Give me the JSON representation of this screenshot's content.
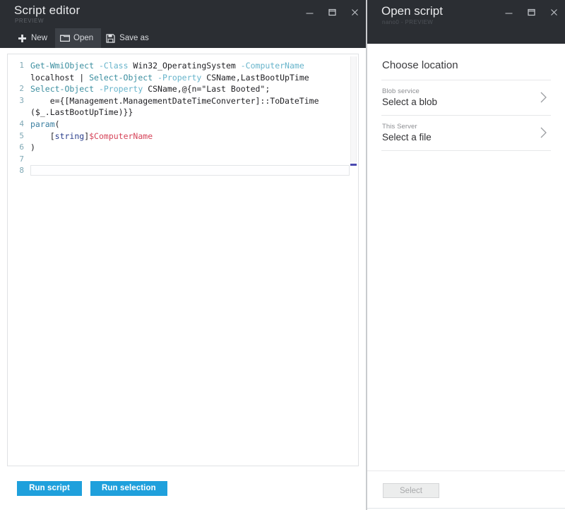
{
  "editor_window": {
    "title": "Script editor",
    "subtitle": "PREVIEW",
    "window_controls": {
      "minimize": "minimize-icon",
      "restore": "restore-icon",
      "close": "close-icon"
    },
    "toolbar": {
      "new_label": "New",
      "new_icon": "plus-icon",
      "open_label": "Open",
      "open_icon": "folder-icon",
      "save_as_label": "Save as",
      "save_as_icon": "floppy-disk-icon",
      "active_item": "Open"
    },
    "code": {
      "language": "powershell",
      "lines": [
        {
          "number": "1",
          "segments": [
            {
              "text": "Get-WmiObject",
              "token": "t-cmd"
            },
            {
              "text": " ",
              "token": "t-txt"
            },
            {
              "text": "-Class",
              "token": "t-par"
            },
            {
              "text": " Win32_OperatingSystem ",
              "token": "t-txt"
            },
            {
              "text": "-ComputerName",
              "token": "t-par"
            },
            {
              "text": "\nlocalhost | ",
              "token": "t-txt"
            },
            {
              "text": "Select-Object",
              "token": "t-cmd"
            },
            {
              "text": " ",
              "token": "t-txt"
            },
            {
              "text": "-Property",
              "token": "t-par"
            },
            {
              "text": " CSName,LastBootUpTime",
              "token": "t-txt"
            }
          ]
        },
        {
          "number": "2",
          "segments": [
            {
              "text": "Select-Object",
              "token": "t-cmd"
            },
            {
              "text": " ",
              "token": "t-txt"
            },
            {
              "text": "-Property",
              "token": "t-par"
            },
            {
              "text": " CSName,@{n=\"Last Booted\";",
              "token": "t-txt"
            }
          ]
        },
        {
          "number": "3",
          "segments": [
            {
              "text": "    e={[Management.ManagementDateTimeConverter]::ToDateTime\n($_.LastBootUpTime)}}",
              "token": "t-txt"
            }
          ]
        },
        {
          "number": "4",
          "segments": [
            {
              "text": "param",
              "token": "t-kw"
            },
            {
              "text": "(",
              "token": "t-txt"
            }
          ]
        },
        {
          "number": "5",
          "segments": [
            {
              "text": "    [",
              "token": "t-txt"
            },
            {
              "text": "string",
              "token": "t-type"
            },
            {
              "text": "]",
              "token": "t-txt"
            },
            {
              "text": "$ComputerName",
              "token": "t-var"
            }
          ]
        },
        {
          "number": "6",
          "segments": [
            {
              "text": ")",
              "token": "t-txt"
            }
          ]
        },
        {
          "number": "7",
          "segments": [
            {
              "text": "",
              "token": "t-txt"
            }
          ]
        },
        {
          "number": "8",
          "segments": [
            {
              "text": "",
              "token": "t-txt"
            }
          ]
        }
      ],
      "active_line": "8"
    },
    "actions": {
      "run_script_label": "Run script",
      "run_selection_label": "Run selection",
      "accent_color": "#1fa0dc"
    }
  },
  "open_script_panel": {
    "title": "Open script",
    "subtitle": "nano0 - PREVIEW",
    "window_controls": {
      "minimize": "minimize-icon",
      "restore": "restore-icon",
      "close": "close-icon"
    },
    "heading": "Choose location",
    "locations": [
      {
        "sub": "Blob service",
        "main": "Select a blob",
        "chevron": "chevron-right-icon"
      },
      {
        "sub": "This Server",
        "main": "Select a file",
        "chevron": "chevron-right-icon"
      }
    ],
    "footer": {
      "select_label": "Select",
      "select_enabled": "false"
    }
  },
  "theme": {
    "titlebar_bg": "#2b2e33",
    "page_bg": "#ffffff",
    "accent": "#1fa0dc",
    "divider": "#c9cbce"
  }
}
